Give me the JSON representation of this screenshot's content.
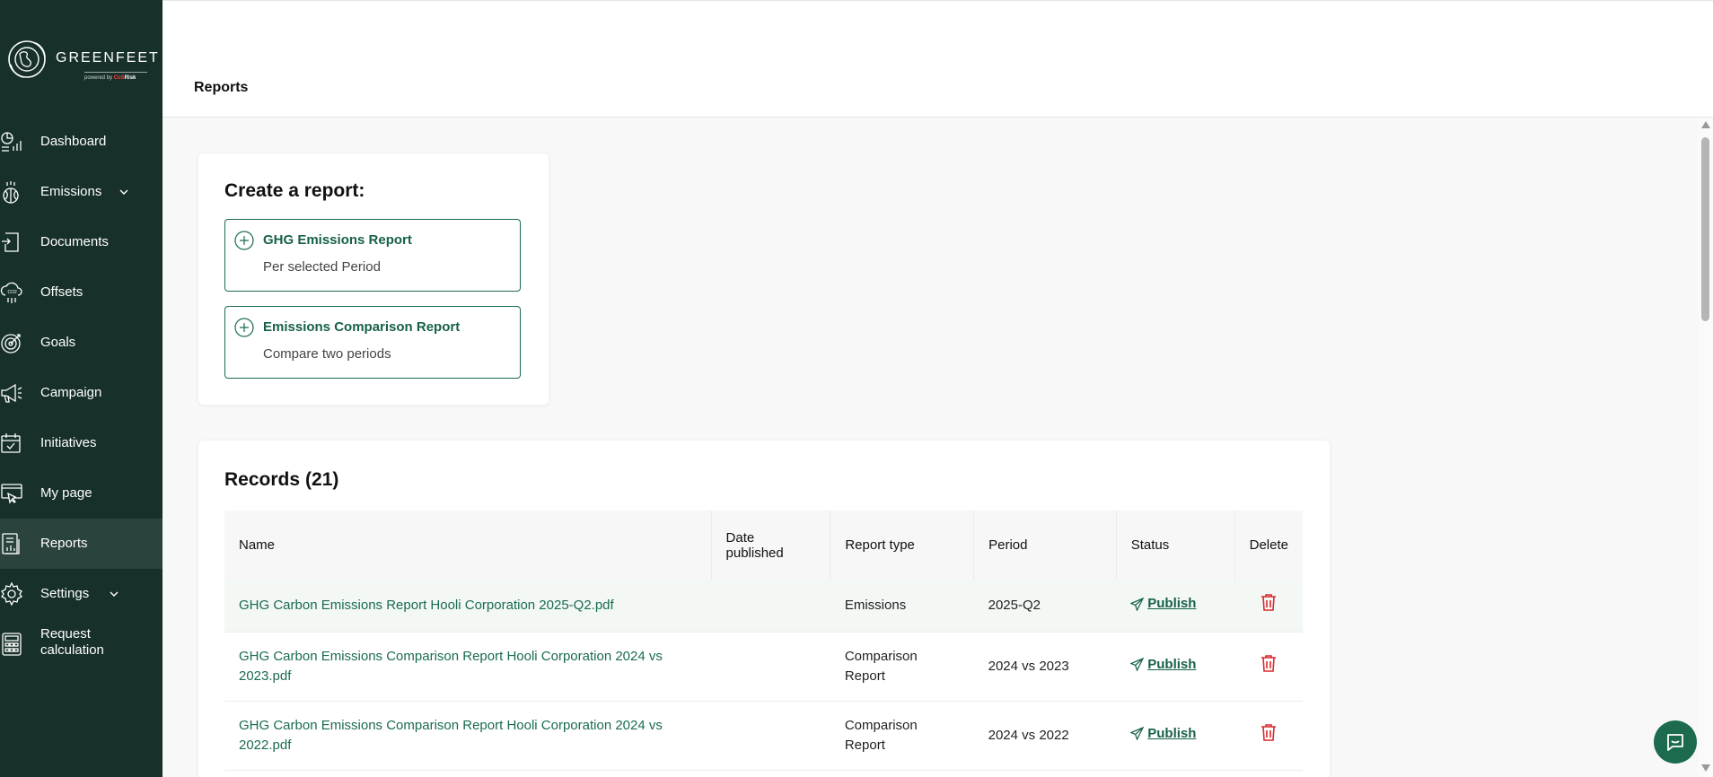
{
  "brand": {
    "name": "GREENFEET",
    "powered_prefix": "powered by",
    "powered_part1": "CoS",
    "powered_part2": "Risk"
  },
  "sidebar": {
    "items": [
      {
        "label": "Dashboard",
        "icon": "dashboard-icon"
      },
      {
        "label": "Emissions",
        "icon": "emissions-icon",
        "has_chevron": true
      },
      {
        "label": "Documents",
        "icon": "documents-icon"
      },
      {
        "label": "Offsets",
        "icon": "offsets-icon"
      },
      {
        "label": "Goals",
        "icon": "goals-icon"
      },
      {
        "label": "Campaign",
        "icon": "campaign-icon"
      },
      {
        "label": "Initiatives",
        "icon": "initiatives-icon"
      },
      {
        "label": "My page",
        "icon": "my-page-icon"
      },
      {
        "label": "Reports",
        "icon": "reports-icon",
        "active": true
      },
      {
        "label": "Settings",
        "icon": "settings-icon",
        "has_chevron": true
      },
      {
        "label": "Request calculation",
        "icon": "calculator-icon"
      }
    ]
  },
  "header": {
    "title": "Reports"
  },
  "create": {
    "title": "Create a report:",
    "options": [
      {
        "title": "GHG Emissions Report",
        "subtitle": "Per selected Period"
      },
      {
        "title": "Emissions Comparison Report",
        "subtitle": "Compare two periods"
      }
    ]
  },
  "records": {
    "title": "Records",
    "count": "(21)",
    "columns": [
      "Name",
      "Date published",
      "Report type",
      "Period",
      "Status",
      "Delete"
    ],
    "rows": [
      {
        "name": "GHG Carbon Emissions Report Hooli Corporation 2025-Q2.pdf",
        "date": "",
        "type": "Emissions",
        "period": "2025-Q2",
        "status": "Publish"
      },
      {
        "name": "GHG Carbon Emissions Comparison Report Hooli Corporation 2024 vs 2023.pdf",
        "date": "",
        "type": "Comparison Report",
        "period": "2024 vs 2023",
        "status": "Publish"
      },
      {
        "name": "GHG Carbon Emissions Comparison Report Hooli Corporation 2024 vs 2022.pdf",
        "date": "",
        "type": "Comparison Report",
        "period": "2024 vs 2022",
        "status": "Publish"
      }
    ]
  },
  "colors": {
    "sidebar_bg": "#17302a",
    "accent": "#1c6b4e",
    "delete": "#d9292c"
  }
}
